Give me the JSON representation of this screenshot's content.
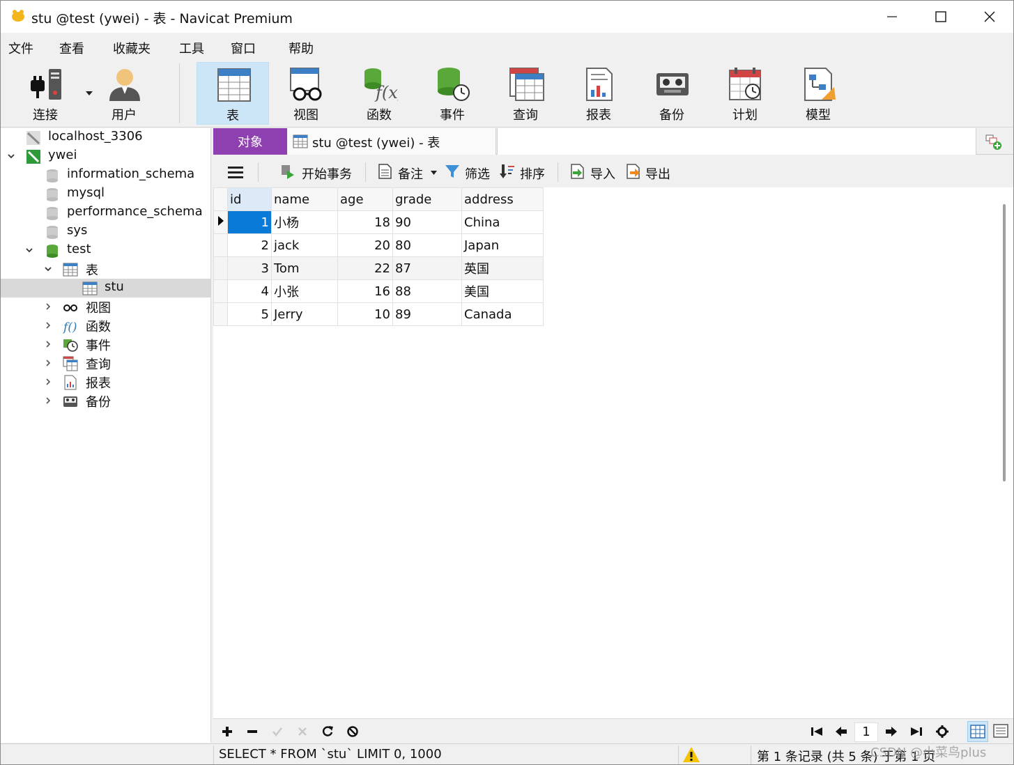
{
  "window": {
    "title": "stu @test (ywei) - 表 - Navicat Premium"
  },
  "menu": [
    "文件",
    "查看",
    "收藏夹",
    "工具",
    "窗口",
    "帮助"
  ],
  "toolbar": {
    "connect": "连接",
    "user": "用户",
    "table": "表",
    "view": "视图",
    "function": "函数",
    "event": "事件",
    "query": "查询",
    "report": "报表",
    "backup": "备份",
    "schedule": "计划",
    "model": "模型"
  },
  "tree": {
    "localhost": "localhost_3306",
    "ywei": "ywei",
    "information_schema": "information_schema",
    "mysql": "mysql",
    "performance_schema": "performance_schema",
    "sys": "sys",
    "test": "test",
    "tables": "表",
    "stu": "stu",
    "views": "视图",
    "functions": "函数",
    "events": "事件",
    "queries": "查询",
    "reports": "报表",
    "backups": "备份"
  },
  "tabs": {
    "objects": "对象",
    "active": "stu @test (ywei) - 表"
  },
  "grid_toolbar": {
    "begin_transaction": "开始事务",
    "memo": "备注",
    "filter": "筛选",
    "sort": "排序",
    "import": "导入",
    "export": "导出"
  },
  "grid": {
    "columns": [
      "id",
      "name",
      "age",
      "grade",
      "address"
    ],
    "rows": [
      [
        "1",
        "小杨",
        "18",
        "90",
        "China"
      ],
      [
        "2",
        "jack",
        "20",
        "80",
        "Japan"
      ],
      [
        "3",
        "Tom",
        "22",
        "87",
        "英国"
      ],
      [
        "4",
        "小张",
        "16",
        "88",
        "美国"
      ],
      [
        "5",
        "Jerry",
        "10",
        "89",
        "Canada"
      ]
    ]
  },
  "pagination": {
    "page": "1"
  },
  "status": {
    "sql": "SELECT * FROM `stu` LIMIT 0, 1000",
    "records": "第 1 条记录 (共 5 条) 于第 1 页",
    "watermark": "CSDN @小菜鸟plus"
  },
  "colors": {
    "objects_tab": "#8e3fb0",
    "selection": "#0a7ad8",
    "toolbar_active": "#cde6f7"
  }
}
